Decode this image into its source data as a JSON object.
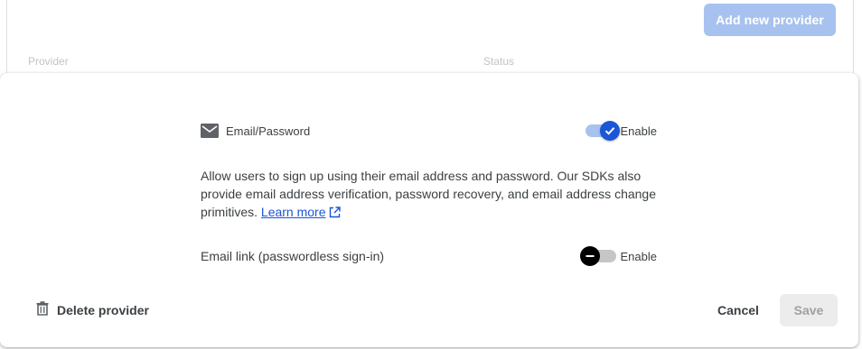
{
  "background_card": {
    "add_provider_label": "Add new provider",
    "columns": [
      "Provider",
      "Status"
    ]
  },
  "panel": {
    "email_provider": {
      "icon": "mail-icon",
      "name": "Email/Password",
      "toggle_label": "Enable",
      "enabled": true
    },
    "description_text": "Allow users to sign up using their email address and password. Our SDKs also provide email address verification, password recovery, and email address change primitives.",
    "learn_more_label": "Learn more",
    "email_link": {
      "name": "Email link (passwordless sign-in)",
      "toggle_label": "Enable",
      "enabled": false
    },
    "delete_label": "Delete provider",
    "cancel_label": "Cancel",
    "save_label": "Save"
  },
  "colors": {
    "accent": "#1a56d6",
    "accent_light": "#a8c2ef",
    "text": "#3c4043",
    "disabled_bg": "#ececec"
  }
}
